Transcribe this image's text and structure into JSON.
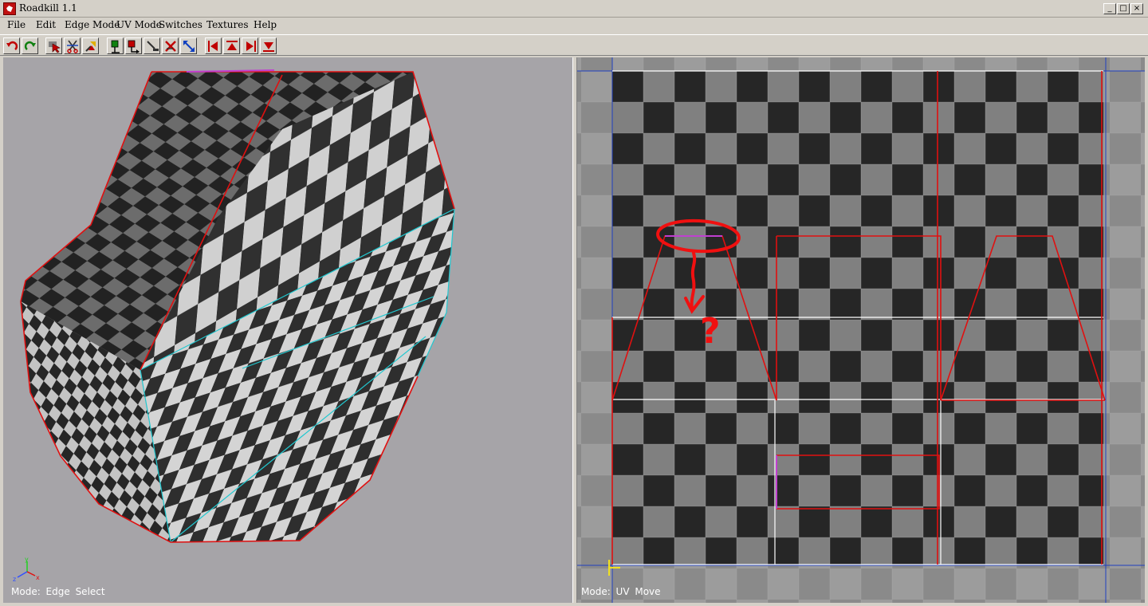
{
  "window": {
    "title": "Roadkill 1.1",
    "minimize_glyph": "_",
    "maximize_glyph": "□",
    "close_glyph": "×"
  },
  "menu": {
    "items": [
      "File",
      "Edit",
      "Edge Mode",
      "UV Mode",
      "Switches",
      "Textures",
      "Help"
    ]
  },
  "toolbar": {
    "buttons": [
      {
        "icon": "undo-icon"
      },
      {
        "icon": "redo-icon"
      },
      {
        "icon": "select-edge-icon"
      },
      {
        "icon": "cut-edge-icon"
      },
      {
        "icon": "weld-icon"
      },
      {
        "icon": "pin-green-icon"
      },
      {
        "icon": "pin-red-icon"
      },
      {
        "icon": "straighten-icon"
      },
      {
        "icon": "unpin-icon"
      },
      {
        "icon": "scale-icon"
      },
      {
        "icon": "align-left-icon"
      },
      {
        "icon": "align-top-icon"
      },
      {
        "icon": "align-right-icon"
      },
      {
        "icon": "align-bottom-icon"
      }
    ]
  },
  "viewport_3d": {
    "mode_label": "Mode: Edge Select",
    "axis_labels": {
      "x": "x",
      "y": "y",
      "z": "z"
    },
    "colors": {
      "background": "#a6a4a8",
      "edge_selected": "#e01010",
      "edge_seam": "#20c8d0"
    }
  },
  "viewport_uv": {
    "mode_label": "Mode: UV Move",
    "annotation_text": "?",
    "colors": {
      "background": "#8a8a8a",
      "island_edge": "#e01010",
      "selected_edge": "#c040d0",
      "uv_bounds": "#ffffff",
      "cursor": "#f0e020"
    }
  }
}
